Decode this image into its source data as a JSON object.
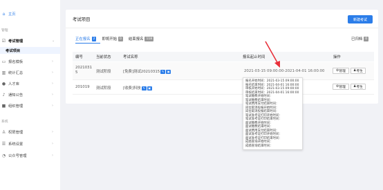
{
  "sidebar": {
    "home": "主页",
    "section_manage": "管理",
    "exam_manage": "考试管理",
    "exam_project": "考试项目",
    "signup_template": "报名模板",
    "stats": "统计汇总",
    "talent_pool": "人才库",
    "notice": "通知公告",
    "org_manage": "组织管理",
    "section_system": "系统",
    "permission": "权限管理",
    "system_settings": "系统设置",
    "official_account": "公众号管理"
  },
  "card": {
    "title": "考试项目",
    "new_button": "新建考试"
  },
  "tabs": [
    {
      "label": "正在报名",
      "count": "2"
    },
    {
      "label": "即将开始",
      "count": "0"
    },
    {
      "label": "结束报名",
      "count": "118"
    }
  ],
  "archive": {
    "label": "已归档",
    "count": "0"
  },
  "table": {
    "headers": [
      "编号",
      "当前状态",
      "考试名称",
      "报名起止时间",
      "操作"
    ],
    "rows": [
      {
        "id_line1": "2021031",
        "id_line2": "5",
        "status": "测试阶段",
        "name": "[免费]测试20210315",
        "period": "2021-03-15 09:00:00-2021-04-01 16:00:00",
        "op1": "管理",
        "op2": "考生"
      },
      {
        "id_line1": "201019",
        "id_line2": "",
        "status": "测试阶段",
        "name": "[收费]科技",
        "period": "",
        "op1": "管理",
        "op2": "考生"
      }
    ]
  },
  "tooltip_lines": [
    "报名开始时间：2021-03-15 09:00:00",
    "报名结束时间：2021-04-01 16:00:00",
    "审核开始时间：2021-03-15 09:00:00",
    "审核结束时间：2021-04-01 16:00:00",
    "笔试缴费开始时间：",
    "笔试缴费结束时间：",
    "笔试费用支付结束时间：",
    "岗位取消投报开始时间：",
    "岗位取消投报结束时间：",
    "笔试准考证打印开始时间：",
    "笔试准考证打印结束时间：",
    "面试缴费开始时间：",
    "面试缴费结束时间：",
    "面试费用支付结束时间：",
    "面试准考证打印开始时间：",
    "面试准考证打印结束时间：",
    "成绩查询开始时间：",
    "成绩查询结束时间："
  ],
  "colors": {
    "accent": "#2b7de9",
    "arrow": "#e8303a"
  }
}
